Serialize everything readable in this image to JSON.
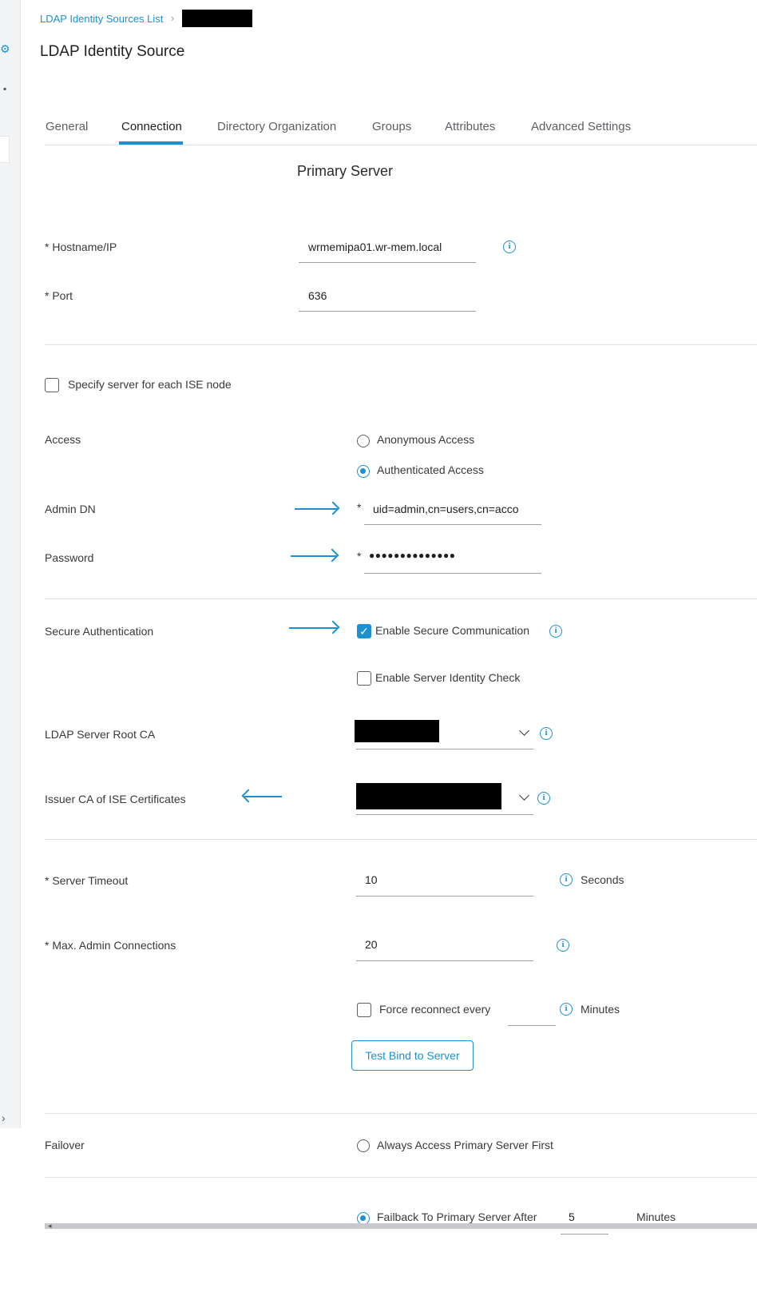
{
  "breadcrumb": {
    "link_label": "LDAP Identity Sources List"
  },
  "page_title": "LDAP Identity Source",
  "tabs": [
    {
      "label": "General"
    },
    {
      "label": "Connection"
    },
    {
      "label": "Directory Organization"
    },
    {
      "label": "Groups"
    },
    {
      "label": "Attributes"
    },
    {
      "label": "Advanced Settings"
    }
  ],
  "active_tab": "Connection",
  "primary_server": {
    "section_title": "Primary Server",
    "hostname": {
      "label": "* Hostname/IP",
      "value": "wrmemipa01.wr-mem.local"
    },
    "port": {
      "label": "* Port",
      "value": "636"
    }
  },
  "specify_server": {
    "label": "Specify server for each ISE node",
    "checked": false
  },
  "access": {
    "label": "Access",
    "options": [
      {
        "label": "Anonymous Access",
        "selected": false
      },
      {
        "label": "Authenticated Access",
        "selected": true
      }
    ]
  },
  "admin_dn": {
    "label": "Admin DN",
    "required_mark": "*",
    "value": "uid=admin,cn=users,cn=acco"
  },
  "password": {
    "label": "Password",
    "required_mark": "*",
    "value": "●●●●●●●●●●●●●●"
  },
  "secure_auth": {
    "label": "Secure Authentication",
    "enable_secure_comm": {
      "label": "Enable Secure Communication",
      "checked": true
    },
    "enable_identity_check": {
      "label": "Enable Server Identity Check",
      "checked": false
    }
  },
  "root_ca": {
    "label": "LDAP Server Root CA"
  },
  "issuer_ca": {
    "label": "Issuer CA of ISE Certificates"
  },
  "server_timeout": {
    "label": "* Server Timeout",
    "value": "10",
    "unit": "Seconds"
  },
  "max_admin_connections": {
    "label": "* Max. Admin Connections",
    "value": "20"
  },
  "force_reconnect": {
    "label": "Force reconnect every",
    "checked": false,
    "value": "",
    "unit": "Minutes"
  },
  "test_bind_button": "Test Bind to Server",
  "failover": {
    "label": "Failover",
    "options": [
      {
        "label": "Always Access Primary Server First",
        "selected": false
      },
      {
        "label": "Failback To Primary Server After",
        "selected": true,
        "value": "5",
        "unit": "Minutes"
      }
    ]
  },
  "icons": {
    "info": "info-icon",
    "gear": "gear-icon",
    "arrow": "arrow-icon",
    "chevron": "chevron-down-icon"
  },
  "colors": {
    "accent": "#1b91d4",
    "text": "#39393b",
    "redaction": "#000000"
  }
}
